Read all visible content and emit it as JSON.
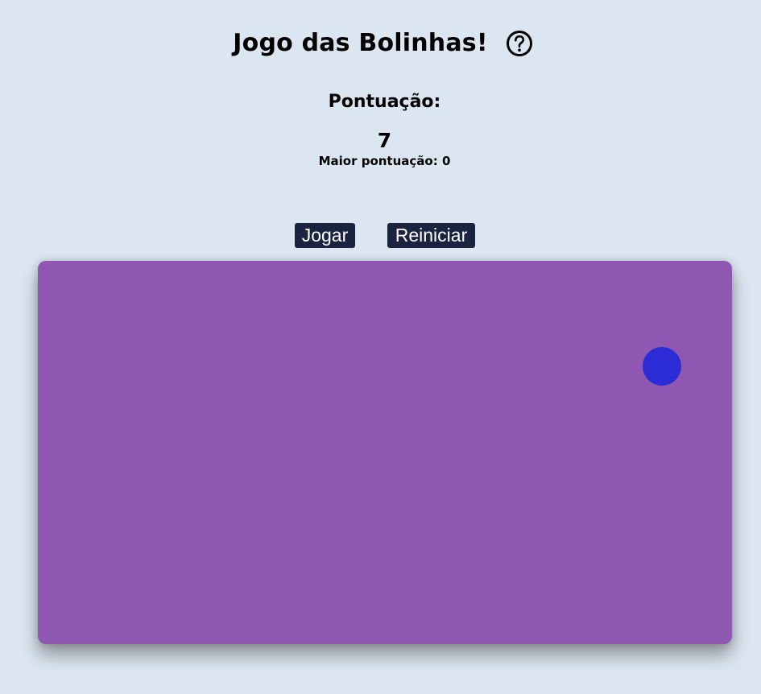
{
  "game": {
    "title": "Jogo das Bolinhas!",
    "help_icon": "question-circle-icon",
    "score_label": "Pontuação:",
    "score_value": "7",
    "best_score_text": "Maior pontuação: 0",
    "buttons": {
      "play_label": "Jogar",
      "reset_label": "Reiniciar"
    }
  },
  "colors": {
    "page_background": "#dce6f0",
    "game_area": "#8f57b1",
    "ball": "#2c2cd6",
    "button_bg": "#1a2340",
    "button_text": "#ffffff"
  }
}
